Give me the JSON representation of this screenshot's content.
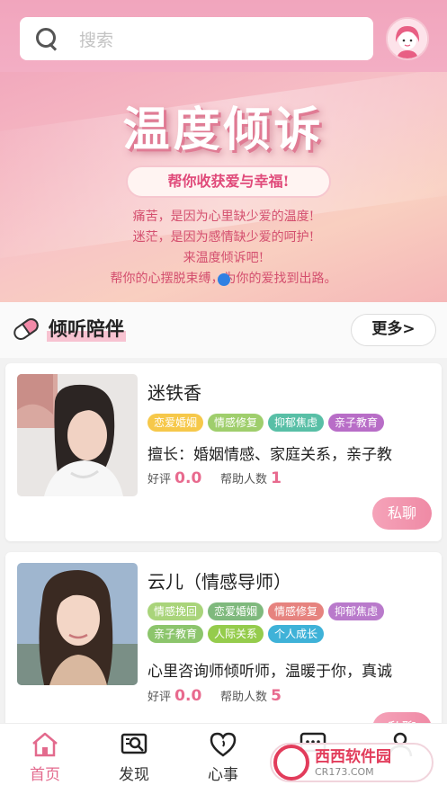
{
  "search": {
    "placeholder": "搜索"
  },
  "banner": {
    "title": "温度倾诉",
    "slogan": "帮你收获爱与幸福!",
    "lines": [
      "痛苦，是因为心里缺少爱的温度!",
      "迷茫，是因为感情缺少爱的呵护!",
      "来温度倾诉吧!",
      "帮你的心摆脱束缚，为你的爱找到出路。"
    ]
  },
  "section": {
    "title": "倾听陪伴",
    "more": "更多>"
  },
  "counselors": [
    {
      "name": "迷铁香",
      "tags": [
        {
          "label": "恋爱婚姻",
          "color": "#f6c84a"
        },
        {
          "label": "情感修复",
          "color": "#9fce6c"
        },
        {
          "label": "抑郁焦虑",
          "color": "#58bfa6"
        },
        {
          "label": "亲子教育",
          "color": "#b86dc7"
        }
      ],
      "desc": "擅长：婚姻情感、家庭关系，亲子教",
      "rating_label": "好评",
      "rating": "0.0",
      "helped_label": "帮助人数",
      "helped": "1",
      "chat": "私聊"
    },
    {
      "name": "云儿（情感导师）",
      "tags": [
        {
          "label": "情感挽回",
          "color": "#a9d47a"
        },
        {
          "label": "恋爱婚姻",
          "color": "#7fb97d"
        },
        {
          "label": "情感修复",
          "color": "#e6837f"
        },
        {
          "label": "抑郁焦虑",
          "color": "#b97acb"
        },
        {
          "label": "亲子教育",
          "color": "#8cc56c"
        },
        {
          "label": "人际关系",
          "color": "#95cc4c"
        },
        {
          "label": "个人成长",
          "color": "#3fb2d8"
        }
      ],
      "desc": "心里咨询师倾听师，温暖于你，真诚",
      "rating_label": "好评",
      "rating": "0.0",
      "helped_label": "帮助人数",
      "helped": "5",
      "chat": "私聊"
    }
  ],
  "tabs": [
    {
      "label": "首页",
      "icon": "home-icon",
      "active": true
    },
    {
      "label": "发现",
      "icon": "discover-icon",
      "active": false
    },
    {
      "label": "心事",
      "icon": "heart-icon",
      "active": false
    },
    {
      "label": "",
      "icon": "message-icon",
      "active": false
    },
    {
      "label": "",
      "icon": "user-icon",
      "active": false
    }
  ],
  "watermark": {
    "brand": "西西软件园",
    "site": "CR173.COM"
  },
  "colors": {
    "accent": "#f1a5bd",
    "active_tab": "#e36a8d",
    "chat_button": "#ef8aa5"
  }
}
